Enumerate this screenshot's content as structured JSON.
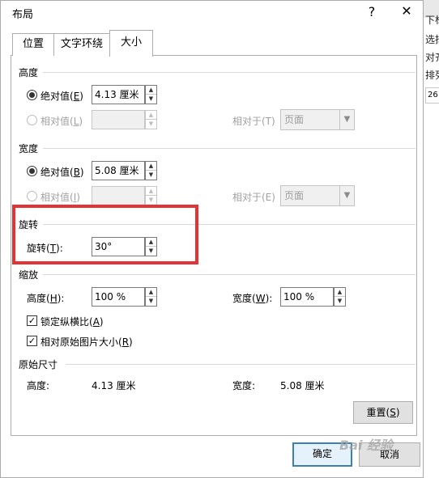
{
  "window": {
    "title": "布局",
    "help": "?",
    "close": "✕"
  },
  "tabs": [
    {
      "label": "位置"
    },
    {
      "label": "文字环绕"
    },
    {
      "label": "大小"
    }
  ],
  "height_section": {
    "title": "高度",
    "absolute_label": "绝对值(",
    "absolute_key": "E",
    "absolute_value": "4.13 厘米",
    "relative_label": "相对值(",
    "relative_key": "L",
    "relative_to_label": "相对于(T)",
    "relative_to_value": "页面"
  },
  "width_section": {
    "title": "宽度",
    "absolute_label": "绝对值(",
    "absolute_key": "B",
    "absolute_value": "5.08 厘米",
    "relative_label": "相对值(",
    "relative_key": "I",
    "relative_to_label": "相对于(E)",
    "relative_to_value": "页面"
  },
  "rotation_section": {
    "title": "旋转",
    "rotation_label": "旋转(",
    "rotation_key": "T",
    "rotation_suffix": "):",
    "rotation_value": "30°"
  },
  "scale_section": {
    "title": "缩放",
    "height_label": "高度(",
    "height_key": "H",
    "height_value": "100 %",
    "width_label": "宽度(",
    "width_key": "W",
    "width_value": "100 %",
    "lock_label": "锁定纵横比(",
    "lock_key": "A",
    "relative_label": "相对原始图片大小(",
    "relative_key": "R"
  },
  "original_section": {
    "title": "原始尺寸",
    "height_label": "高度:",
    "height_value": "4.13 厘米",
    "width_label": "宽度:",
    "width_value": "5.08 厘米"
  },
  "buttons": {
    "reset_label": "重置(",
    "reset_key": "S",
    "ok": "确定",
    "cancel": "取消"
  },
  "background": {
    "items": [
      "下标",
      "选择",
      "对齐",
      "排列"
    ],
    "box": "26"
  },
  "watermark": "Bai 经验",
  "colors": {
    "highlight": "#e23434",
    "default_button_border": "#3c7fb1"
  }
}
